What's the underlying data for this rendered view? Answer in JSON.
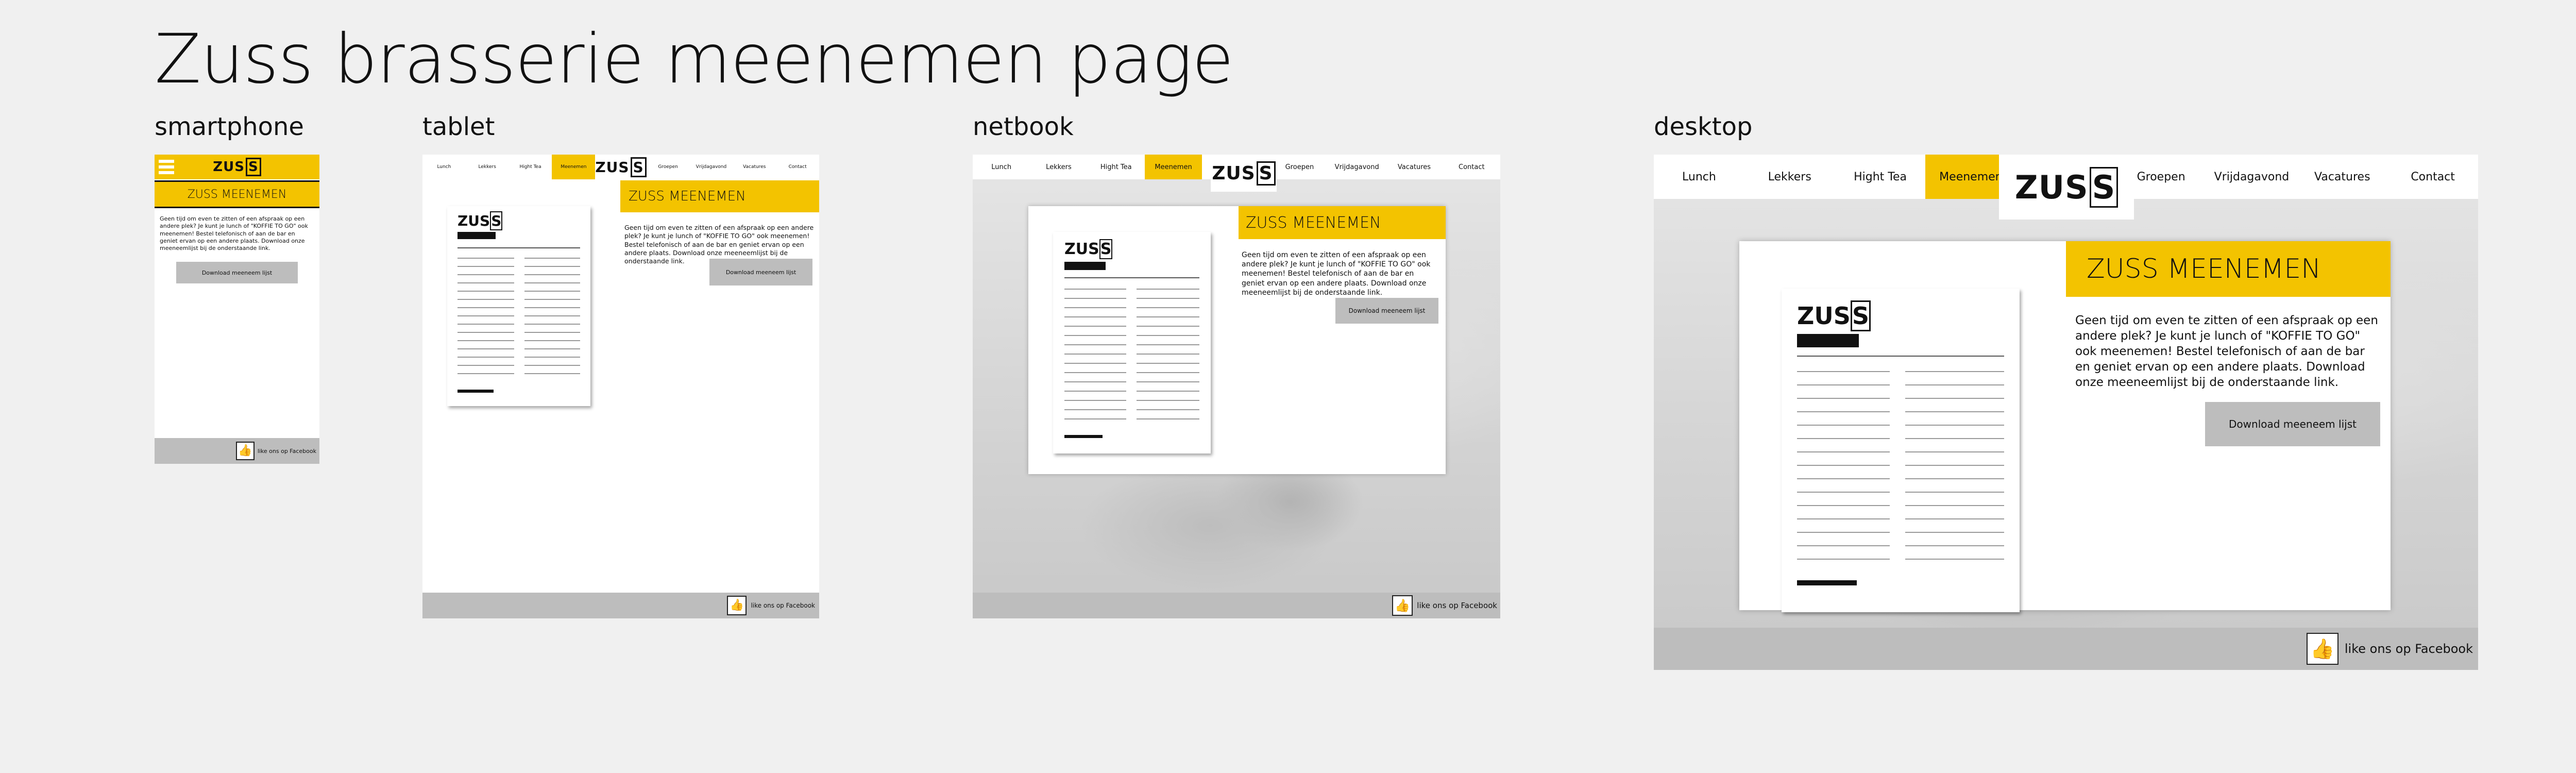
{
  "title": "Zuss brasserie meenemen page",
  "labels": {
    "smartphone": "smartphone",
    "tablet": "tablet",
    "netbook": "netbook",
    "desktop": "desktop"
  },
  "nav": [
    "Lunch",
    "Lekkers",
    "Hight Tea",
    "Meenemen",
    "Groepen",
    "Vrijdagavond",
    "Vacatures",
    "Contact"
  ],
  "logo": {
    "text": "ZUS",
    "box": "S"
  },
  "heading": "ZUSS MEENEMEN",
  "body": "Geen tijd om even te zitten of een afspraak op een andere plek? Je kunt je lunch of \"KOFFIE TO GO\" ook meenemen! Bestel telefonisch of aan de bar en geniet ervan op een andere plaats. Download onze meeneemlijst bij de onderstaande link.",
  "download_btn": "Download meeneem lijst",
  "footer": "like ons op Facebook",
  "colors": {
    "accent": "#f3c300",
    "footer": "#bdbdbd"
  }
}
